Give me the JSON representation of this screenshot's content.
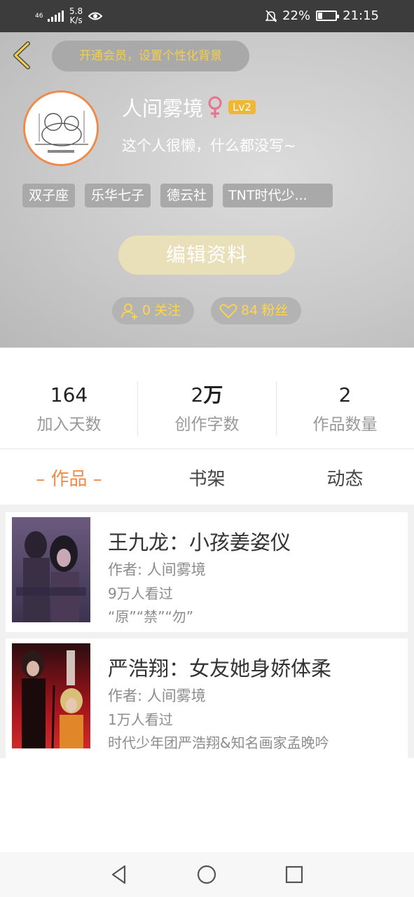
{
  "status_bar": {
    "network_type": "46",
    "speed_value": "5.8",
    "speed_unit": "K/s",
    "battery_percent": "22%",
    "time": "21:15"
  },
  "header": {
    "vip_banner": "开通会员，设置个性化背景",
    "username": "人间雾境",
    "gender_symbol": "♀",
    "level": "Lv2",
    "bio": "这个人很懒，什么都没写~",
    "tags": [
      "双子座",
      "乐华七子",
      "德云社",
      "TNT时代少..."
    ],
    "edit_button": "编辑资料",
    "follow_count": "0",
    "follow_label": "关注",
    "fans_count": "84",
    "fans_label": "粉丝"
  },
  "stats": [
    {
      "value_num": "164",
      "value_unit": "",
      "label": "加入天数"
    },
    {
      "value_num": "2",
      "value_unit": "万",
      "label": "创作字数"
    },
    {
      "value_num": "2",
      "value_unit": "",
      "label": "作品数量"
    }
  ],
  "tabs": {
    "works": "– 作品 –",
    "bookshelf": "书架",
    "activity": "动态"
  },
  "works": [
    {
      "title": "王九龙：小孩姜姿仪",
      "author": "作者: 人间雾境",
      "views": "9万人看过",
      "desc": "“原”“禁”“勿”"
    },
    {
      "title": "严浩翔：女友她身娇体柔",
      "author": "作者: 人间雾境",
      "views": "1万人看过",
      "desc": "时代少年团严浩翔&知名画家孟晚吟"
    }
  ],
  "colors": {
    "accent": "#f28a4c",
    "vip_text": "#f3cf4a",
    "level_badge": "#f1b733",
    "follow_text": "#ffd64a"
  }
}
